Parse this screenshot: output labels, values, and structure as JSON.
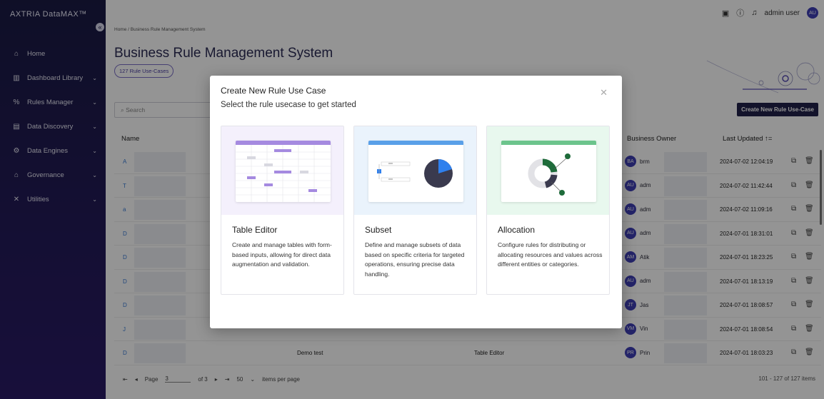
{
  "sidebar": {
    "logo": "AXTRIA DataMAX™",
    "collapse_icon": "chevron-left-icon",
    "items": [
      {
        "label": "Home",
        "icon": "home-icon",
        "has_chevron": false
      },
      {
        "label": "Dashboard Library",
        "icon": "chart-icon",
        "has_chevron": true
      },
      {
        "label": "Rules Manager",
        "icon": "percent-icon",
        "has_chevron": true
      },
      {
        "label": "Data Discovery",
        "icon": "document-icon",
        "has_chevron": true
      },
      {
        "label": "Data Engines",
        "icon": "gears-icon",
        "has_chevron": true
      },
      {
        "label": "Governance",
        "icon": "bank-icon",
        "has_chevron": true
      },
      {
        "label": "Utilities",
        "icon": "tools-icon",
        "has_chevron": true
      }
    ]
  },
  "topbar": {
    "user_name": "admin user",
    "user_initials": "AU"
  },
  "breadcrumb": "Home / Business Rule Management System",
  "page_title": "Business Rule Management System",
  "count_badge": "127 Rule Use-Cases",
  "search_placeholder": "Search",
  "create_button": "Create New Rule Use-Case",
  "table": {
    "headers": {
      "name": "Name",
      "owner": "Business Owner",
      "updated": "Last Updated ↑="
    },
    "rows": [
      {
        "name": "A",
        "initials": "BA",
        "owner": "brm",
        "date": "2024-07-02 12:04:19",
        "desc": "",
        "type": ""
      },
      {
        "name": "T",
        "initials": "AU",
        "owner": "adm",
        "date": "2024-07-02 11:42:44",
        "desc": "",
        "type": ""
      },
      {
        "name": "a",
        "initials": "AU",
        "owner": "adm",
        "date": "2024-07-02 11:09:16",
        "desc": "",
        "type": ""
      },
      {
        "name": "D",
        "initials": "AU",
        "owner": "adm",
        "date": "2024-07-01 18:31:01",
        "desc": "",
        "type": ""
      },
      {
        "name": "D",
        "initials": "AM",
        "owner": "Atik",
        "date": "2024-07-01 18:23:25",
        "desc": "",
        "type": ""
      },
      {
        "name": "D",
        "initials": "AU",
        "owner": "adm",
        "date": "2024-07-01 18:13:19",
        "desc": "",
        "type": ""
      },
      {
        "name": "D",
        "initials": "JT",
        "owner": "Jas",
        "date": "2024-07-01 18:08:57",
        "desc": "",
        "type": ""
      },
      {
        "name": "J",
        "initials": "VM",
        "owner": "Vin",
        "date": "2024-07-01 18:08:54",
        "desc": "",
        "type": ""
      },
      {
        "name": "D",
        "initials": "PR",
        "owner": "Prin",
        "date": "2024-07-01 18:03:23",
        "desc": "Demo test",
        "type": "Table Editor"
      }
    ]
  },
  "pager": {
    "page_label": "Page",
    "page_value": "3",
    "of_label": "of 3",
    "per_page": "50",
    "per_page_label": "items per page",
    "summary": "101 - 127 of 127 items"
  },
  "modal": {
    "title": "Create New Rule Use Case",
    "subtitle": "Select the rule usecase to get started",
    "close_icon": "close-icon",
    "cards": [
      {
        "name": "Table Editor",
        "desc": "Create and manage tables with form-based inputs, allowing for direct data augmentation and validation.",
        "bg": "#f4f0fc"
      },
      {
        "name": "Subset",
        "desc": "Define and manage subsets of data based on specific criteria for targeted operations, ensuring precise data handling.",
        "bg": "#eaf3fc"
      },
      {
        "name": "Allocation",
        "desc": "Configure rules for distributing or allocating resources and values across different entities or categories.",
        "bg": "#e8f8ee"
      }
    ]
  },
  "colors": {
    "sidebar": "#1a1a44",
    "accent": "#3f3fb5",
    "purple": "#a58ae0",
    "blue": "#2f80ed",
    "green": "#1e6b3a"
  }
}
